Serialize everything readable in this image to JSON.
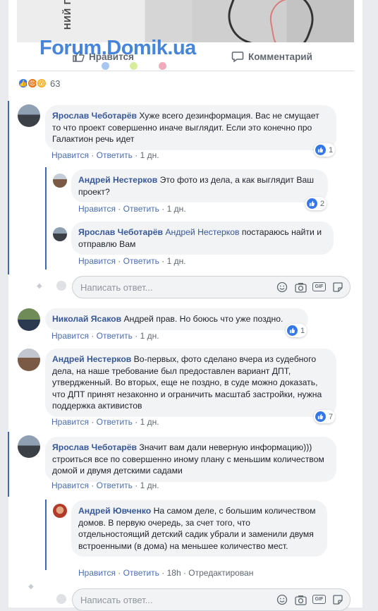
{
  "post": {
    "photo_text": "НИЙ П",
    "watermark": "Forum.Domik.ua",
    "like_label": "Нравится",
    "comment_label": "Комментарий",
    "reaction_count": "63"
  },
  "comments": [
    {
      "author": "Ярослав Чеботарёв",
      "text": "Хуже всего дезинформация. Вас не смущает то что проект совершенно иначе выглядит. Если это конечно про Галактион речь идет",
      "like": "Нравится",
      "reply": "Ответить",
      "time": "1 дн.",
      "likes": "1"
    },
    {
      "author": "Андрей Нестерков",
      "text": "Это фото из дела, а как выглядит Ваш проект?",
      "like": "Нравится",
      "reply": "Ответить",
      "time": "1 дн.",
      "likes": "2"
    },
    {
      "author": "Ярослав Чеботарёв",
      "tag": "Андрей Нестерков",
      "text": "постараюсь найти и отправлю Вам",
      "like": "Нравится",
      "reply": "Ответить",
      "time": "1 дн."
    },
    {
      "author": "Николай Ясаков",
      "text": "Андрей прав. Но боюсь что уже поздно.",
      "like": "Нравится",
      "reply": "Ответить",
      "time": "1 дн.",
      "likes": "1"
    },
    {
      "author": "Андрей Нестерков",
      "text": "Во-первых, фото сделано вчера из судебного дела, на наше требование был предоставлен вариант ДПТ, утвердженный. Во вторых, еще не поздно, в суде можно доказать, что ДПТ принят незаконно и ограничить масштаб застройки, нужна поддержка активистов",
      "like": "Нравится",
      "reply": "Ответить",
      "time": "1 дн.",
      "likes": "7"
    },
    {
      "author": "Ярослав Чеботарёв",
      "text": "Значит вам дали неверную информацию))) строиться все по совершенно иному плану с меньшим количеством домой и двумя детскими садами",
      "like": "Нравится",
      "reply": "Ответить",
      "time": "1 дн."
    },
    {
      "author": "Андрей Ювченко",
      "text": "На самом деле, с большим количеством домов. В первую очередь, за счет того, что отдельностоящий детский садик убрали и заменили двумя встроенными (в дома) на меньшее количество мест.",
      "like": "Нравится",
      "reply": "Ответить",
      "time": "18h",
      "edited": "Отредактирован"
    }
  ],
  "reply_box": {
    "placeholder": "Написать ответ..."
  },
  "colors": {
    "link": "#385898",
    "accent": "#4267b2",
    "bubble": "#f2f3f5",
    "like_blue": "#3578e5"
  }
}
